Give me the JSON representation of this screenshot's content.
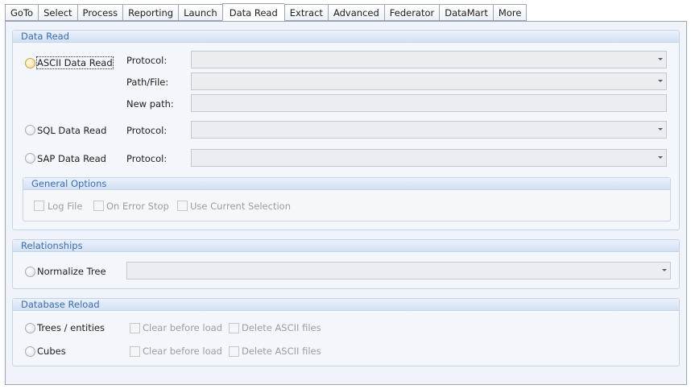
{
  "tabs": [
    "GoTo",
    "Select",
    "Process",
    "Reporting",
    "Launch",
    "Data Read",
    "Extract",
    "Advanced",
    "Federator",
    "DataMart",
    "More"
  ],
  "active_tab": "Data Read",
  "data_read": {
    "title": "Data Read",
    "ascii": {
      "label": "ASCII Data Read",
      "protocol_label": "Protocol:",
      "protocol_value": "",
      "path_label": "Path/File:",
      "path_value": "",
      "newpath_label": "New path:",
      "newpath_value": ""
    },
    "sql": {
      "label": "SQL Data Read",
      "protocol_label": "Protocol:",
      "protocol_value": ""
    },
    "sap": {
      "label": "SAP Data Read",
      "protocol_label": "Protocol:",
      "protocol_value": ""
    },
    "general_options": {
      "title": "General Options",
      "log_file": "Log File",
      "on_error_stop": "On Error Stop",
      "use_current_selection": "Use Current Selection"
    }
  },
  "relationships": {
    "title": "Relationships",
    "normalize_label": "Normalize Tree",
    "normalize_value": ""
  },
  "database_reload": {
    "title": "Database Reload",
    "trees_label": "Trees / entities",
    "cubes_label": "Cubes",
    "clear_before_load": "Clear before load",
    "delete_ascii_files": "Delete ASCII files"
  }
}
